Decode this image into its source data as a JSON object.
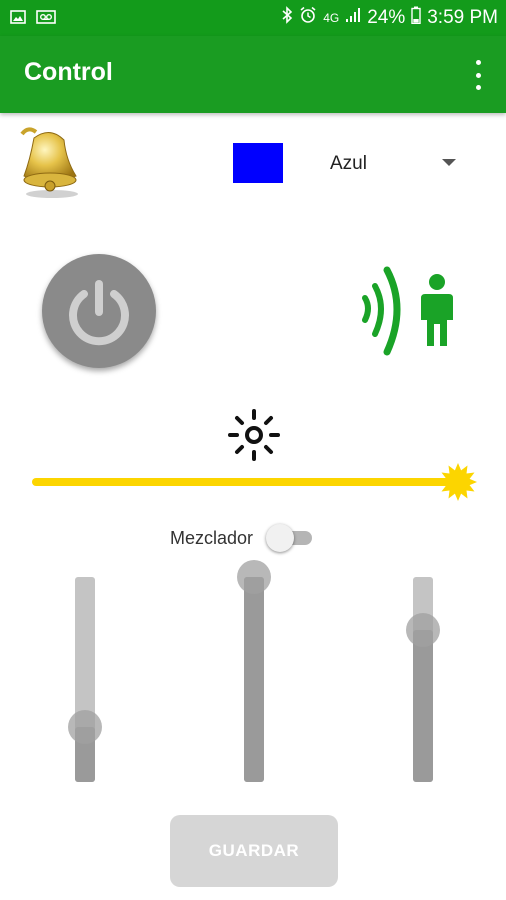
{
  "status_bar": {
    "network": "4G",
    "battery": "24%",
    "time": "3:59 PM",
    "icons": [
      "image-icon",
      "voicemail-icon",
      "bluetooth-icon",
      "alarm-icon",
      "signal-icon",
      "battery-icon"
    ]
  },
  "app_bar": {
    "title": "Control",
    "menu_icon": "more-vert-icon"
  },
  "colors": {
    "primary": "#1a9c22",
    "selected_color": "#0000ff",
    "presence_icon": "#1aa327",
    "brightness": "#fcd500"
  },
  "color_select": {
    "value": "Azul"
  },
  "brightness": {
    "level": 1.0
  },
  "mixer": {
    "label": "Mezclador",
    "enabled": false,
    "sliders": [
      {
        "channel": 1,
        "level": 0.27
      },
      {
        "channel": 2,
        "level": 1.0
      },
      {
        "channel": 3,
        "level": 0.74
      }
    ]
  },
  "save_button": {
    "label": "GUARDAR",
    "enabled": false
  }
}
